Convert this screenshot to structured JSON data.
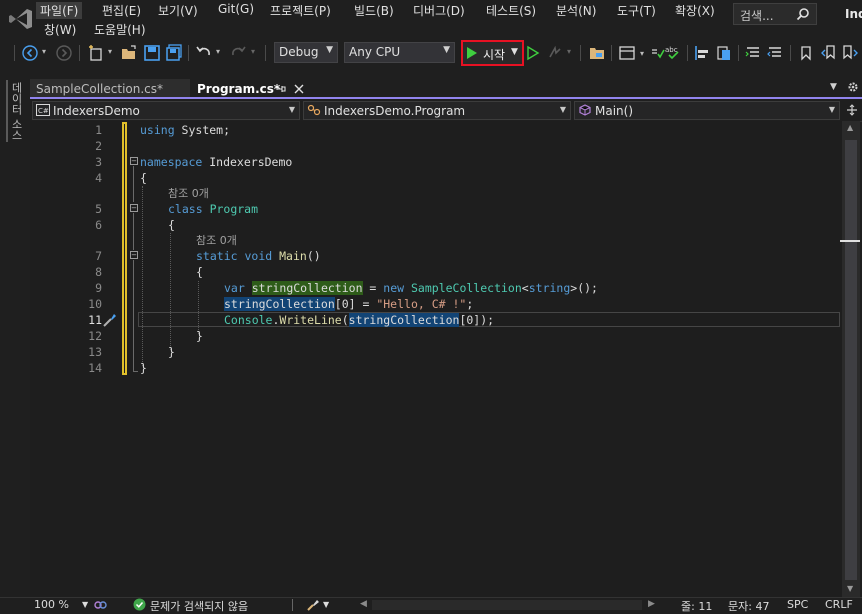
{
  "menu": {
    "items": [
      "파일(F)",
      "편집(E)",
      "보기(V)",
      "Git(G)",
      "프로젝트(P)",
      "빌드(B)",
      "디버그(D)",
      "테스트(S)",
      "분석(N)",
      "도구(T)",
      "확장(X)"
    ],
    "row2": [
      "창(W)",
      "도움말(H)"
    ],
    "search_placeholder": "검색...",
    "app_name": "Ind"
  },
  "toolbar": {
    "configuration": "Debug",
    "platform": "Any CPU",
    "start_label": "시작"
  },
  "side_tab": "데이터 소스",
  "tabs": [
    {
      "label": "SampleCollection.cs*",
      "active": false
    },
    {
      "label": "Program.cs*",
      "active": true
    }
  ],
  "navbar": {
    "project": "IndexersDemo",
    "type": "IndexersDemo.Program",
    "member": "Main()"
  },
  "editor": {
    "line_numbers": [
      "1",
      "2",
      "3",
      "4",
      "",
      "5",
      "6",
      "",
      "7",
      "8",
      "9",
      "10",
      "11",
      "12",
      "13",
      "14"
    ],
    "ref_hint_1": "참조 0개",
    "ref_hint_2": "참조 0개"
  },
  "status": {
    "zoom": "100 %",
    "issues": "문제가 검색되지 않음",
    "line": "줄: 11",
    "col": "문자: 47",
    "spc": "SPC",
    "crlf": "CRLF"
  },
  "colors": {
    "accent": "#9184ee",
    "highlight_border": "#e81123",
    "keyword": "#569cd6",
    "type": "#4ec9b0",
    "string": "#d69d85"
  }
}
